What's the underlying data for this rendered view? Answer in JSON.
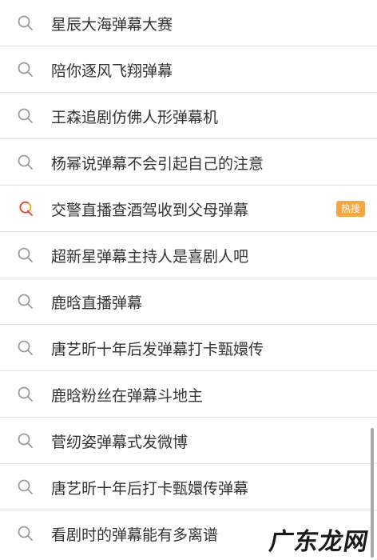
{
  "colors": {
    "text": "#333333",
    "divider": "#e4e4e4",
    "search_icon": "#9a9a9a",
    "hot_icon_orange": "#f5a623",
    "hot_icon_red": "#e8473a",
    "hot_badge": "#f7a742"
  },
  "suggestions": [
    {
      "label": "星辰大海弹幕大赛",
      "icon": "search-icon"
    },
    {
      "label": "陪你逐风飞翔弹幕",
      "icon": "search-icon"
    },
    {
      "label": "王森追剧仿佛人形弹幕机",
      "icon": "search-icon"
    },
    {
      "label": "杨幂说弹幕不会引起自己的注意",
      "icon": "search-icon"
    },
    {
      "label": "交警直播查酒驾收到父母弹幕",
      "icon": "hot-search-icon",
      "badge": "热搜"
    },
    {
      "label": "超新星弹幕主持人是喜剧人吧",
      "icon": "search-icon"
    },
    {
      "label": "鹿晗直播弹幕",
      "icon": "search-icon"
    },
    {
      "label": "唐艺昕十年后发弹幕打卡甄嬛传",
      "icon": "search-icon"
    },
    {
      "label": "鹿晗粉丝在弹幕斗地主",
      "icon": "search-icon"
    },
    {
      "label": "菅纫姿弹幕式发微博",
      "icon": "search-icon"
    },
    {
      "label": "唐艺昕十年后打卡甄嬛传弹幕",
      "icon": "search-icon"
    },
    {
      "label": "看剧时的弹幕能有多离谱",
      "icon": "search-icon"
    }
  ],
  "watermark": "广东龙网"
}
